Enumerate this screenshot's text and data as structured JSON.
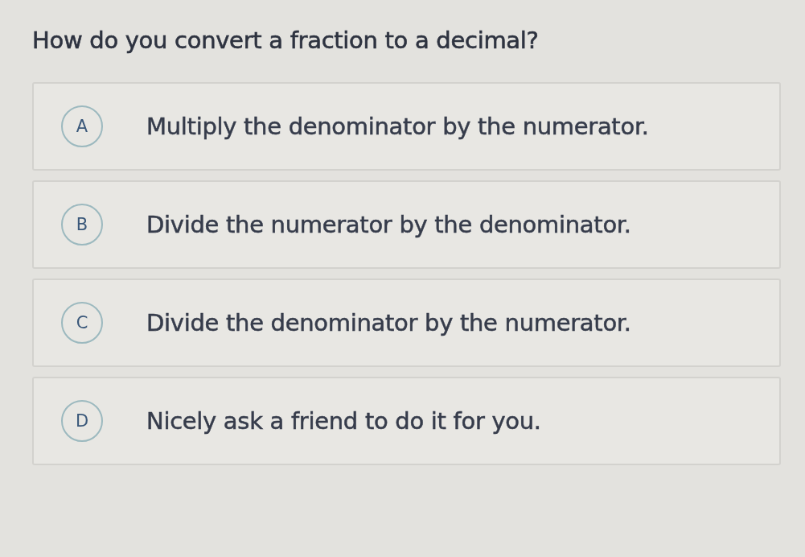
{
  "question": "How do you convert a fraction to a decimal?",
  "options": [
    {
      "letter": "A",
      "text": "Multiply the denominator by the numerator.",
      "selected": false
    },
    {
      "letter": "B",
      "text": "Divide the numerator by the denominator.",
      "selected": false
    },
    {
      "letter": "C",
      "text": "Divide the denominator by the numerator.",
      "selected": false
    },
    {
      "letter": "D",
      "text": "Nicely ask a friend to do it for you.",
      "selected": false
    }
  ]
}
